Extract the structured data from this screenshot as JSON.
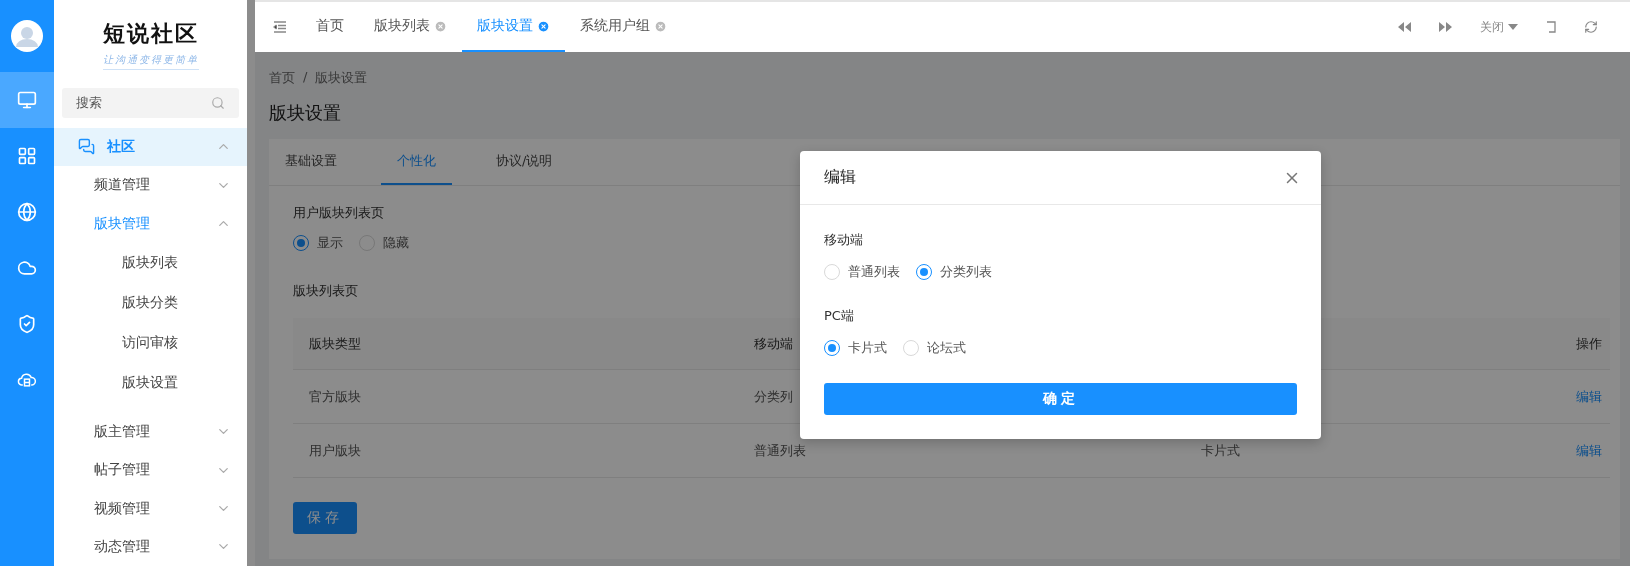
{
  "rail": {
    "items": [
      {
        "selected": true
      },
      {
        "selected": false
      },
      {
        "selected": false
      },
      {
        "selected": false
      },
      {
        "selected": false
      },
      {
        "selected": false
      }
    ]
  },
  "brand": {
    "title": "短说社区",
    "slogan": "让沟通变得更简单"
  },
  "search": {
    "placeholder": "搜索"
  },
  "sidebar": {
    "items": [
      {
        "label": "社区",
        "selected": true,
        "expanded": true,
        "children": [
          {
            "label": "频道管理",
            "selected": false,
            "expanded": false
          },
          {
            "label": "版块管理",
            "selected": true,
            "expanded": true,
            "children": [
              {
                "label": "版块列表",
                "selected": false
              },
              {
                "label": "版块分类",
                "selected": false
              },
              {
                "label": "访问审核",
                "selected": false
              },
              {
                "label": "版块设置",
                "selected": false
              }
            ]
          },
          {
            "label": "版主管理",
            "selected": false,
            "expanded": false
          },
          {
            "label": "帖子管理",
            "selected": false,
            "expanded": false
          },
          {
            "label": "视频管理",
            "selected": false,
            "expanded": false
          },
          {
            "label": "动态管理",
            "selected": false,
            "expanded": false
          }
        ]
      }
    ]
  },
  "tabs": [
    {
      "label": "首页",
      "closable": false,
      "selected": false
    },
    {
      "label": "版块列表",
      "closable": true,
      "selected": false
    },
    {
      "label": "版块设置",
      "closable": true,
      "selected": true
    },
    {
      "label": "系统用户组",
      "closable": true,
      "selected": false
    }
  ],
  "toolbar": {
    "close_menu": "关闭"
  },
  "breadcrumb": {
    "items": [
      "首页",
      "版块设置"
    ],
    "separator": "/"
  },
  "page_title": "版块设置",
  "settings_tabs": [
    {
      "label": "基础设置",
      "selected": false
    },
    {
      "label": "个性化",
      "selected": true
    },
    {
      "label": "协议/说明",
      "selected": false
    }
  ],
  "user_list_page": {
    "label": "用户版块列表页",
    "options": [
      {
        "label": "显示",
        "selected": true
      },
      {
        "label": "隐藏",
        "selected": false
      }
    ]
  },
  "table": {
    "title": "版块列表页",
    "columns": [
      "版块类型",
      "移动端",
      "操作"
    ],
    "rows": [
      {
        "type": "官方版块",
        "mobile": "分类列",
        "action": "编辑"
      },
      {
        "type": "用户版块",
        "mobile": "普通列表",
        "column_3": "卡片式",
        "action": "编辑"
      }
    ]
  },
  "save_button": "保存",
  "modal": {
    "title": "编辑",
    "groups": [
      {
        "label": "移动端",
        "options": [
          {
            "label": "普通列表",
            "selected": false
          },
          {
            "label": "分类列表",
            "selected": true
          }
        ]
      },
      {
        "label": "PC端",
        "options": [
          {
            "label": "卡片式",
            "selected": true
          },
          {
            "label": "论坛式",
            "selected": false
          }
        ]
      }
    ],
    "confirm": "确定"
  }
}
